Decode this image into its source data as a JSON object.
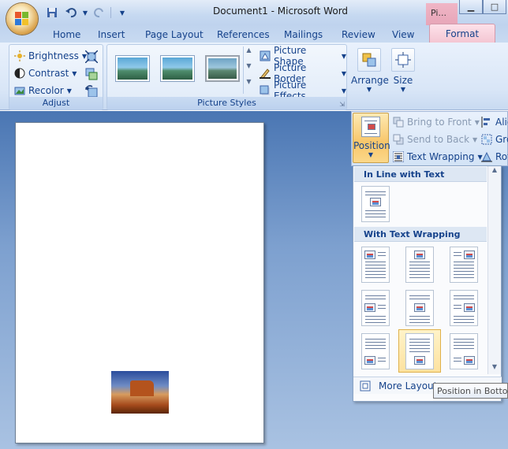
{
  "window": {
    "title": "Document1 - Microsoft Word",
    "context_tab_top": "Pi...",
    "minimize": "▁",
    "maximize": "□"
  },
  "tabs": [
    "Home",
    "Insert",
    "Page Layout",
    "References",
    "Mailings",
    "Review",
    "View"
  ],
  "active_tab": "Format",
  "adjust": {
    "brightness": "Brightness",
    "contrast": "Contrast",
    "recolor": "Recolor",
    "group_label": "Adjust"
  },
  "picture_styles": {
    "shape": "Picture Shape",
    "border": "Picture Border",
    "effects": "Picture Effects",
    "group_label": "Picture Styles"
  },
  "arrange": {
    "label": "Arrange"
  },
  "size": {
    "label": "Size"
  },
  "arrange_panel": {
    "position": "Position",
    "bring_to_front": "Bring to Front",
    "send_to_back": "Send to Back",
    "text_wrapping": "Text Wrapping",
    "align": "Alig",
    "group": "Gro",
    "rotate": "Rot"
  },
  "position_menu": {
    "inline_header": "In Line with Text",
    "wrap_header": "With Text Wrapping",
    "more_layout": "More Layout...",
    "tooltip": "Position in Bottom Center"
  }
}
